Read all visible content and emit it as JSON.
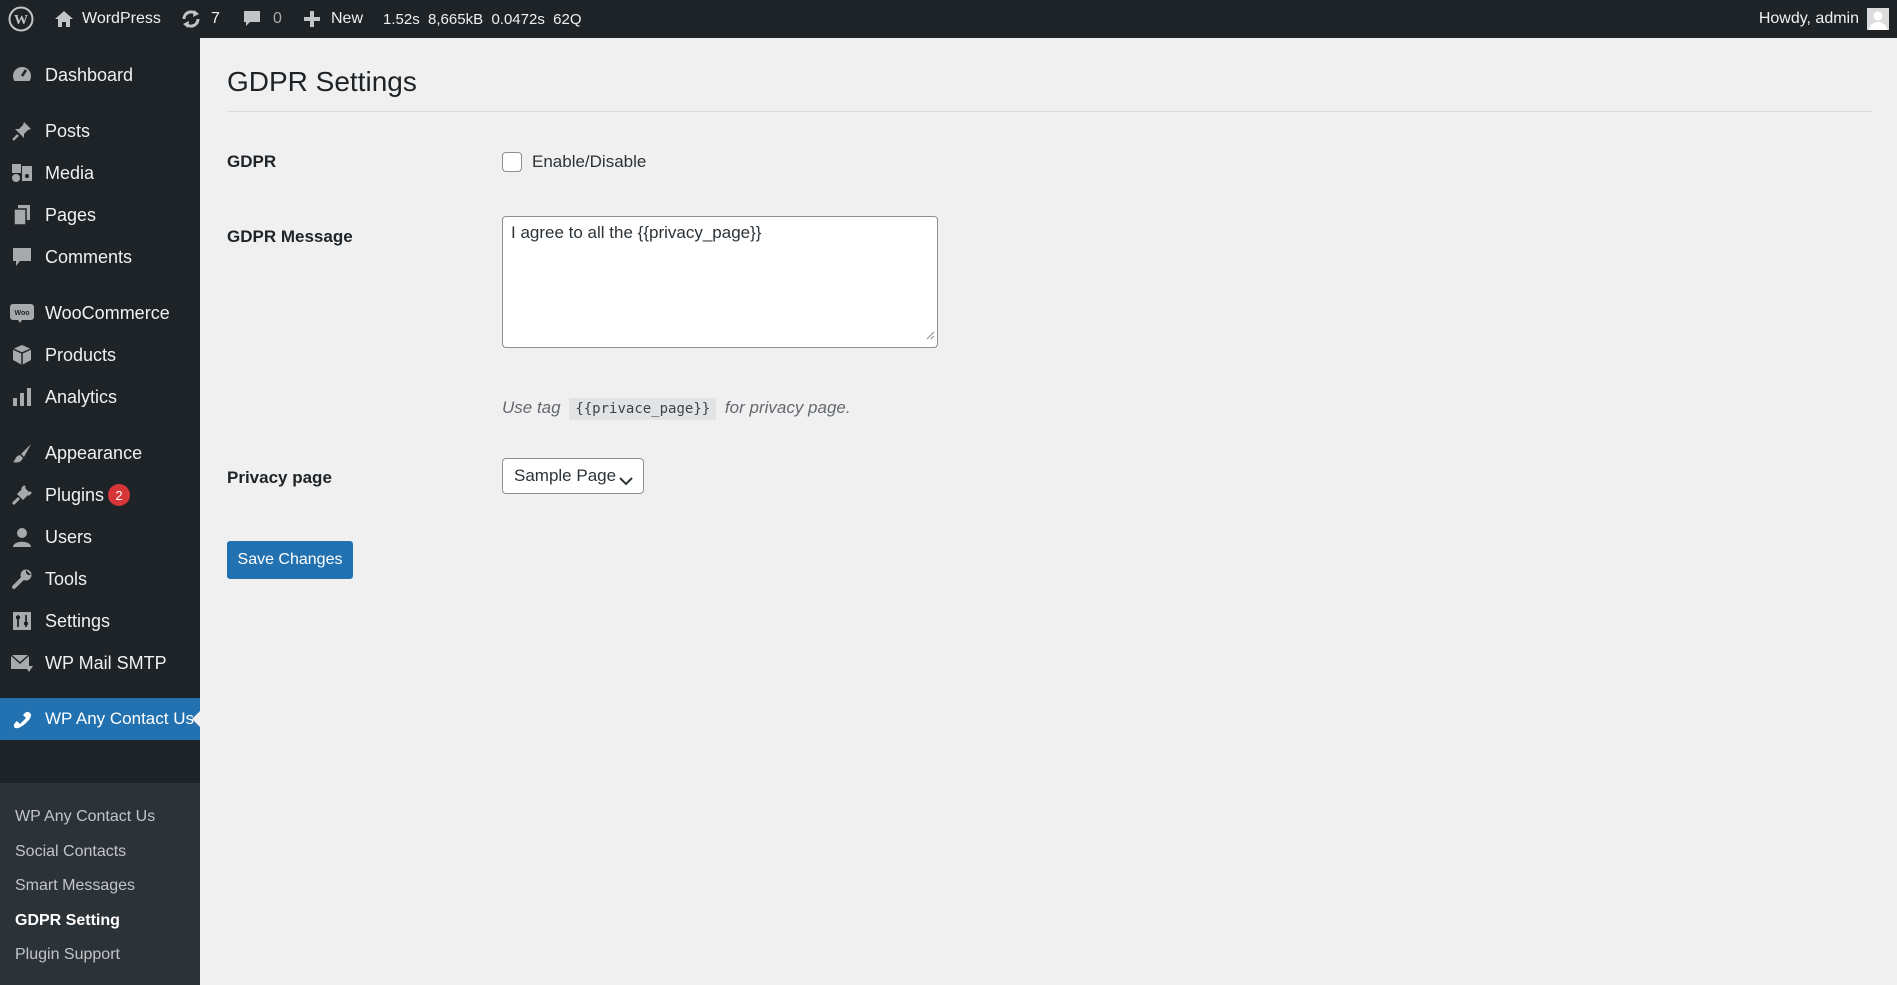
{
  "admin_bar": {
    "site_name": "WordPress",
    "updates_count": "7",
    "comments_count": "0",
    "new_label": "New",
    "query_time": "1.52s",
    "memory": "8,665kB",
    "db_time": "0.0472s",
    "queries": "62Q",
    "greeting": "Howdy, admin"
  },
  "sidebar": {
    "dashboard": "Dashboard",
    "posts": "Posts",
    "media": "Media",
    "pages": "Pages",
    "comments": "Comments",
    "woocommerce": "WooCommerce",
    "products": "Products",
    "analytics": "Analytics",
    "appearance": "Appearance",
    "plugins": "Plugins",
    "plugins_badge": "2",
    "users": "Users",
    "tools": "Tools",
    "settings": "Settings",
    "wp_mail_smtp": "WP Mail SMTP",
    "current_menu": "WP Any Contact Us",
    "submenu": {
      "item1": "WP Any Contact Us",
      "item2": "Social Contacts",
      "item3": "Smart Messages",
      "item4": "GDPR Setting",
      "item5": "Plugin Support"
    }
  },
  "page": {
    "title": "GDPR Settings",
    "gdpr_label": "GDPR",
    "enable_label": "Enable/Disable",
    "enable_checked": false,
    "message_label": "GDPR Message",
    "message_value": "I agree to all the {{privacy_page}}",
    "desc_before": "Use tag",
    "desc_code": "{{privace_page}}",
    "desc_after": "for privacy page.",
    "privacy_label": "Privacy page",
    "privacy_selected": "Sample Page",
    "save_label": "Save Changes"
  },
  "colors": {
    "accent": "#2271b1",
    "sidebar_bg": "#1d2327",
    "badge": "#d63638"
  }
}
